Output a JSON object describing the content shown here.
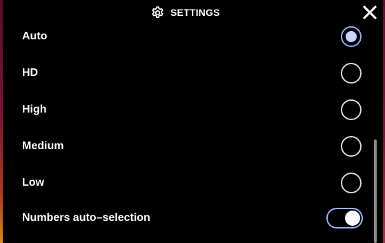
{
  "header": {
    "title": "SETTINGS",
    "settings_icon": "gear-icon",
    "close_icon": "close-icon"
  },
  "quality_options": [
    {
      "label": "Auto",
      "selected": true
    },
    {
      "label": "HD",
      "selected": false
    },
    {
      "label": "High",
      "selected": false
    },
    {
      "label": "Medium",
      "selected": false
    },
    {
      "label": "Low",
      "selected": false
    }
  ],
  "numbers_auto_selection": {
    "label": "Numbers auto–selection",
    "enabled": true
  },
  "colors": {
    "background": "#000000",
    "text": "#ffffff",
    "accent": "#9ab4ff",
    "radio_selected_fill": "#c8d4ff"
  }
}
